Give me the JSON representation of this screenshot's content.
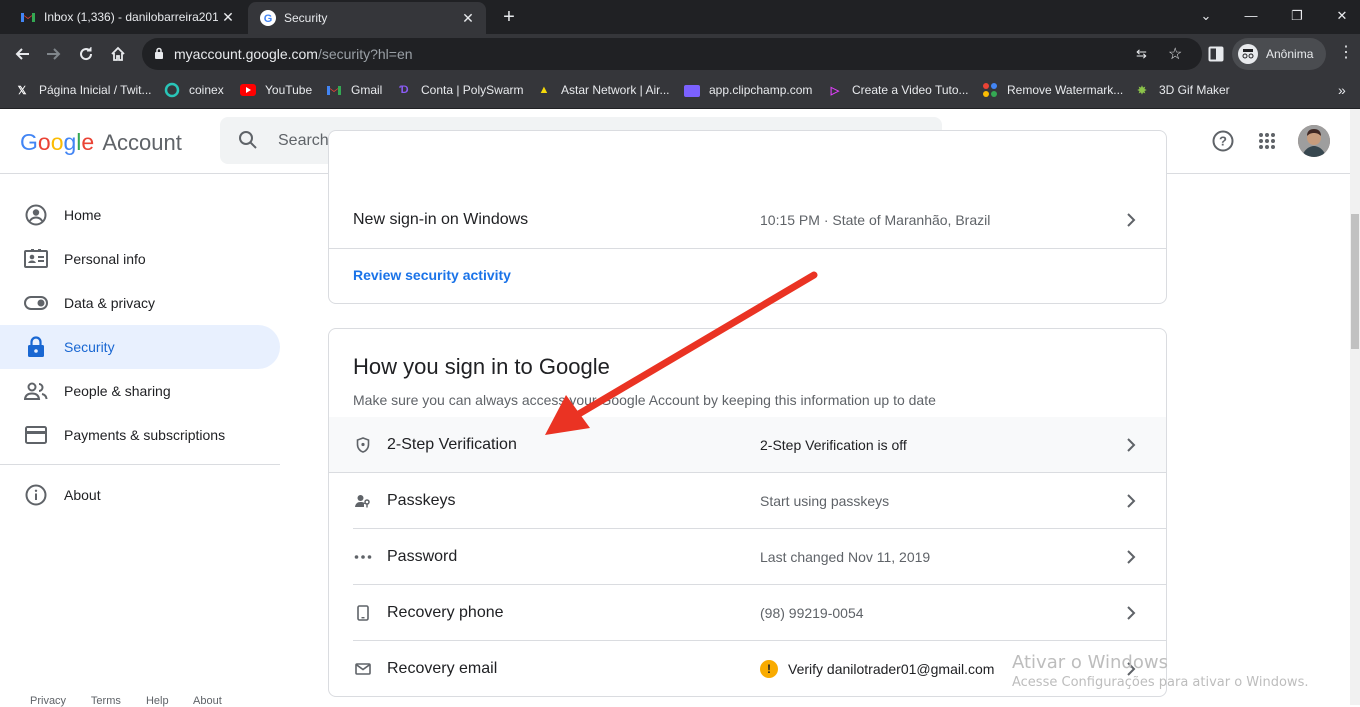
{
  "browser": {
    "tabs": [
      {
        "title": "Inbox (1,336) - danilobarreira201",
        "favicon": "gmail-icon"
      },
      {
        "title": "Security",
        "favicon": "google-icon",
        "active": true
      }
    ],
    "url_host": "myaccount.google.com",
    "url_path": "/security?hl=en",
    "profile_label": "Anônima",
    "bookmarks": [
      {
        "label": "Página Inicial / Twit...",
        "icon": "x-icon"
      },
      {
        "label": "coinex",
        "icon": "coinex-icon"
      },
      {
        "label": "YouTube",
        "icon": "youtube-icon"
      },
      {
        "label": "Gmail",
        "icon": "gmail-icon"
      },
      {
        "label": "Conta | PolySwarm",
        "icon": "polyswarm-icon"
      },
      {
        "label": "Astar Network | Air...",
        "icon": "astar-icon"
      },
      {
        "label": "app.clipchamp.com",
        "icon": "clipchamp-icon"
      },
      {
        "label": "Create a Video Tuto...",
        "icon": "video-icon"
      },
      {
        "label": "Remove Watermark...",
        "icon": "dots-icon"
      },
      {
        "label": "3D Gif Maker",
        "icon": "gif-icon"
      }
    ]
  },
  "header": {
    "logo_google": "Google",
    "logo_account": "Account",
    "search_placeholder": "Search Google Account"
  },
  "sidebar": {
    "items": [
      {
        "label": "Home",
        "icon": "account-circle-icon"
      },
      {
        "label": "Personal info",
        "icon": "id-card-icon"
      },
      {
        "label": "Data & privacy",
        "icon": "toggle-icon"
      },
      {
        "label": "Security",
        "icon": "lock-icon",
        "active": true
      },
      {
        "label": "People & sharing",
        "icon": "people-icon"
      },
      {
        "label": "Payments & subscriptions",
        "icon": "credit-card-icon"
      },
      {
        "label": "About",
        "icon": "info-icon"
      }
    ],
    "footer": [
      "Privacy",
      "Terms",
      "Help",
      "About"
    ]
  },
  "recent_activity": {
    "rows": [
      {
        "label": "New sign-in on Windows",
        "value": "10:15 PM · State of Maranhão, Brazil"
      }
    ],
    "link": "Review security activity"
  },
  "signin": {
    "title": "How you sign in to Google",
    "subtitle": "Make sure you can always access your Google Account by keeping this information up to date",
    "rows": [
      {
        "label": "2-Step Verification",
        "value": "2-Step Verification is off",
        "icon": "shield-icon"
      },
      {
        "label": "Passkeys",
        "value": "Start using passkeys",
        "icon": "person-key-icon"
      },
      {
        "label": "Password",
        "value": "Last changed Nov 11, 2019",
        "icon": "password-dots-icon"
      },
      {
        "label": "Recovery phone",
        "value": "(98) 99219-0054",
        "icon": "phone-icon"
      },
      {
        "label": "Recovery email",
        "value": "Verify danilotrader01@gmail.com",
        "icon": "mail-icon",
        "warning": true
      }
    ]
  },
  "watermark": {
    "line1": "Ativar o Windows",
    "line2": "Acesse Configurações para ativar o Windows."
  },
  "colors": {
    "accent": "#1a73e8",
    "active_bg": "#e8f0fe",
    "arrow": "#ea3323",
    "warning": "#f9ab00"
  }
}
